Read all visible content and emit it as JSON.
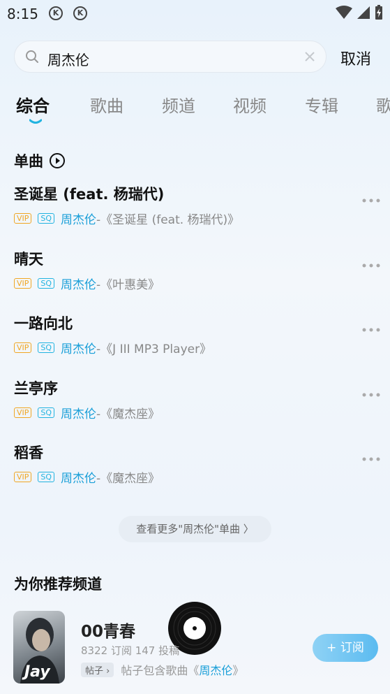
{
  "status_bar": {
    "time": "8:15",
    "k_icons": [
      "K",
      "K"
    ]
  },
  "search": {
    "query": "周杰伦",
    "cancel_label": "取消"
  },
  "tabs": [
    {
      "label": "综合",
      "active": true
    },
    {
      "label": "歌曲",
      "active": false
    },
    {
      "label": "频道",
      "active": false
    },
    {
      "label": "视频",
      "active": false
    },
    {
      "label": "专辑",
      "active": false
    },
    {
      "label": "歌",
      "active": false
    }
  ],
  "singles": {
    "title": "单曲",
    "items": [
      {
        "title": "圣诞星 (feat. 杨瑞代)",
        "vip": "VIP",
        "sq": "SQ",
        "artist": "周杰伦",
        "album": " -《圣诞星 (feat. 杨瑞代)》"
      },
      {
        "title": "晴天",
        "vip": "VIP",
        "sq": "SQ",
        "artist": "周杰伦",
        "album": " -《叶惠美》"
      },
      {
        "title": "一路向北",
        "vip": "VIP",
        "sq": "SQ",
        "artist": "周杰伦",
        "album": " -《J III MP3 Player》"
      },
      {
        "title": "兰亭序",
        "vip": "VIP",
        "sq": "SQ",
        "artist": "周杰伦",
        "album": " -《魔杰座》"
      },
      {
        "title": "稻香",
        "vip": "VIP",
        "sq": "SQ",
        "artist": "周杰伦",
        "album": " -《魔杰座》"
      }
    ],
    "more_label": "查看更多\"周杰伦\"单曲 〉"
  },
  "recommend": {
    "title": "为你推荐频道",
    "channel": {
      "name": "00青春",
      "cover_text": "Jay",
      "stats": "8322 订阅   147 投稿",
      "tag": "帖子 ›",
      "desc_prefix": "帖子包含歌曲《",
      "desc_highlight": "周杰伦",
      "desc_suffix": "》",
      "subscribe_label": "+ 订阅"
    }
  },
  "colors": {
    "accent": "#1a9fd8",
    "vip": "#f0a623",
    "sq": "#21b3e0"
  }
}
